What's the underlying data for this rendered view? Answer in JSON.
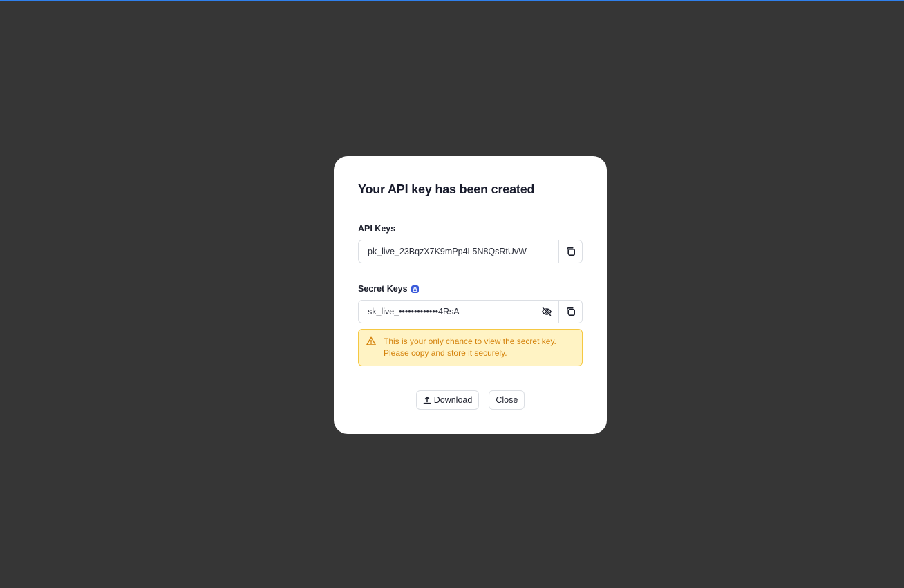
{
  "colors": {
    "backdrop": "#363636",
    "accent_bar": "#2f80ed",
    "warning_bg": "#fff3c4",
    "warning_text": "#d4820b",
    "lock_badge": "#3b5bdb"
  },
  "dialog": {
    "title": "Your API key has been created",
    "api_keys": {
      "label": "API Keys",
      "value": "pk_live_23BqzX7K9mPp4L5N8QsRtUvW",
      "copy_icon": "copy-icon"
    },
    "secret_keys": {
      "label": "Secret Keys",
      "label_icon": "lock-icon",
      "value": "sk_live_•••••••••••••4RsA",
      "visibility_icon": "eye-off-icon",
      "copy_icon": "copy-icon"
    },
    "warning": {
      "icon": "warning-triangle-icon",
      "line1": "This is your only chance to view the secret key.",
      "line2": "Please copy and store it securely."
    },
    "actions": {
      "download_label": "Download",
      "download_icon": "upload-icon",
      "close_label": "Close"
    }
  }
}
